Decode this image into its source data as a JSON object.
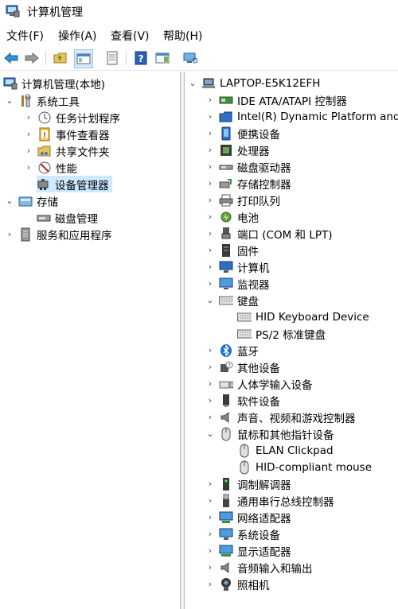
{
  "window": {
    "title": "计算机管理"
  },
  "menu": [
    "文件(F)",
    "操作(A)",
    "查看(V)",
    "帮助(H)"
  ],
  "left_tree": [
    {
      "label": "计算机管理(本地)",
      "icon": "computer-management-icon"
    },
    {
      "label": "系统工具",
      "icon": "system-tools-icon"
    },
    {
      "label": "任务计划程序",
      "icon": "clock-icon"
    },
    {
      "label": "事件查看器",
      "icon": "event-viewer-icon"
    },
    {
      "label": "共享文件夹",
      "icon": "shared-folder-icon"
    },
    {
      "label": "性能",
      "icon": "performance-icon"
    },
    {
      "label": "设备管理器",
      "icon": "device-manager-icon",
      "selected": true
    },
    {
      "label": "存储",
      "icon": "storage-icon"
    },
    {
      "label": "磁盘管理",
      "icon": "disk-management-icon"
    },
    {
      "label": "服务和应用程序",
      "icon": "services-icon"
    }
  ],
  "device_tree": [
    {
      "label": "LAPTOP-E5K12EFH",
      "icon": "laptop-icon"
    },
    {
      "label": "IDE ATA/ATAPI 控制器",
      "icon": "ide-controller-icon"
    },
    {
      "label": "Intel(R) Dynamic Platform and T",
      "icon": "folder-icon"
    },
    {
      "label": "便携设备",
      "icon": "portable-device-icon"
    },
    {
      "label": "处理器",
      "icon": "processor-icon"
    },
    {
      "label": "磁盘驱动器",
      "icon": "disk-drive-icon"
    },
    {
      "label": "存储控制器",
      "icon": "storage-controller-icon"
    },
    {
      "label": "打印队列",
      "icon": "printer-icon"
    },
    {
      "label": "电池",
      "icon": "battery-icon"
    },
    {
      "label": "端口 (COM 和 LPT)",
      "icon": "port-icon"
    },
    {
      "label": "固件",
      "icon": "firmware-icon"
    },
    {
      "label": "计算机",
      "icon": "computer-icon"
    },
    {
      "label": "监视器",
      "icon": "monitor-icon"
    },
    {
      "label": "键盘",
      "icon": "keyboard-icon"
    },
    {
      "label": "HID Keyboard Device",
      "icon": "keyboard-icon"
    },
    {
      "label": "PS/2 标准键盘",
      "icon": "keyboard-icon"
    },
    {
      "label": "蓝牙",
      "icon": "bluetooth-icon"
    },
    {
      "label": "其他设备",
      "icon": "unknown-device-icon"
    },
    {
      "label": "人体学输入设备",
      "icon": "hid-icon"
    },
    {
      "label": "软件设备",
      "icon": "software-device-icon"
    },
    {
      "label": "声音、视频和游戏控制器",
      "icon": "speaker-icon"
    },
    {
      "label": "鼠标和其他指针设备",
      "icon": "mouse-icon"
    },
    {
      "label": "ELAN Clickpad",
      "icon": "mouse-icon"
    },
    {
      "label": "HID-compliant mouse",
      "icon": "mouse-icon"
    },
    {
      "label": "调制解调器",
      "icon": "modem-icon"
    },
    {
      "label": "通用串行总线控制器",
      "icon": "usb-icon"
    },
    {
      "label": "网络适配器",
      "icon": "network-adapter-icon"
    },
    {
      "label": "系统设备",
      "icon": "system-device-icon"
    },
    {
      "label": "显示适配器",
      "icon": "display-adapter-icon"
    },
    {
      "label": "音频输入和输出",
      "icon": "audio-io-icon"
    },
    {
      "label": "照相机",
      "icon": "camera-icon"
    }
  ]
}
